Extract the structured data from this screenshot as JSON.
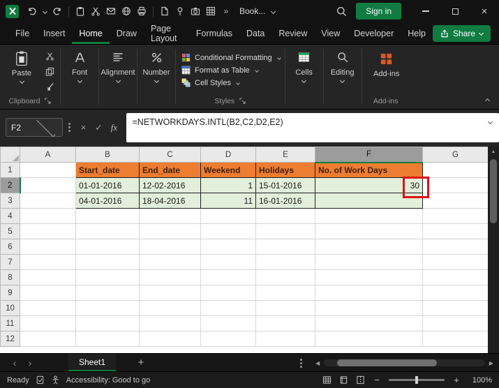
{
  "titlebar": {
    "workbook_name": "Book...",
    "sign_in": "Sign in"
  },
  "menubar": {
    "items": [
      "File",
      "Insert",
      "Home",
      "Draw",
      "Page Layout",
      "Formulas",
      "Data",
      "Review",
      "View",
      "Developer",
      "Help"
    ],
    "active_item": "Home",
    "share": "Share"
  },
  "ribbon": {
    "paste": "Paste",
    "buttons": {
      "font": "Font",
      "alignment": "Alignment",
      "number": "Number",
      "cells": "Cells",
      "editing": "Editing",
      "addins": "Add-ins"
    },
    "styles_menu": [
      "Conditional Formatting",
      "Format as Table",
      "Cell Styles"
    ],
    "group_labels": {
      "clipboard": "Clipboard",
      "styles": "Styles",
      "addins": "Add-ins"
    }
  },
  "formula_bar": {
    "name_box": "F2",
    "fx_label": "fx",
    "formula": "=NETWORKDAYS.INTL(B2,C2,D2,E2)"
  },
  "grid": {
    "col_headers": [
      "A",
      "B",
      "C",
      "D",
      "E",
      "F",
      "G"
    ],
    "row_headers": [
      "1",
      "2",
      "3",
      "4",
      "5",
      "6",
      "7",
      "8",
      "9",
      "10",
      "11",
      "12"
    ],
    "active_cell": "F2",
    "table": {
      "r1": {
        "B": "Start_date",
        "C": "End_date",
        "D": "Weekend",
        "E": "Holidays",
        "F": "No. of Work Days"
      },
      "r2": {
        "B": "01-01-2016",
        "C": "12-02-2016",
        "D": "1",
        "E": "15-01-2016",
        "F": "30"
      },
      "r3": {
        "B": "04-01-2016",
        "C": "18-04-2016",
        "D": "11",
        "E": "16-01-2016"
      }
    }
  },
  "sheetbar": {
    "tabs": [
      "Sheet1"
    ],
    "active_tab": "Sheet1"
  },
  "statusbar": {
    "mode": "Ready",
    "accessibility": "Accessibility: Good to go",
    "zoom_level": "100%"
  },
  "icons": {
    "overflow": "»",
    "close": "×",
    "cancel": "×",
    "confirm": "✓",
    "nav_prev": "‹",
    "nav_next": "›",
    "add_sheet": "+",
    "scroll_up": "▲",
    "scroll_left": "◀",
    "scroll_right": "▶",
    "zoom_out": "−",
    "zoom_in": "+"
  },
  "colors": {
    "accent_green": "#107C41",
    "header_fill": "#ED7D31",
    "data_fill": "#E2EFDA",
    "annotation_red": "#E01111"
  }
}
